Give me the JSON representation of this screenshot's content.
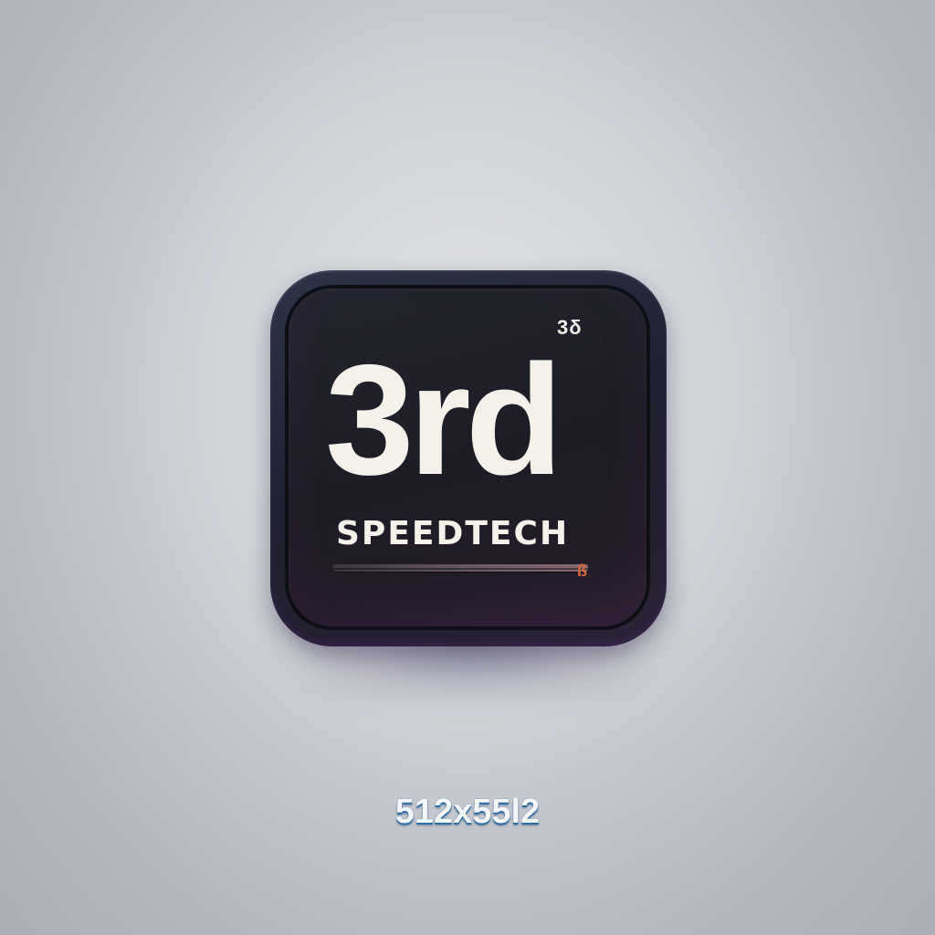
{
  "icon": {
    "corner_mark": "3δ",
    "title": "3rd",
    "subtitle": "SPEEDTECH",
    "bar_end_glyph": "ß"
  },
  "caption": {
    "dimensions": "512x55l2"
  },
  "colors": {
    "background": "#c8cbd0",
    "icon_body": "#1f2231",
    "text": "#f3f1e9",
    "bar_accent": "#d46a3a",
    "caption_shadow": "#2f6fa8"
  }
}
